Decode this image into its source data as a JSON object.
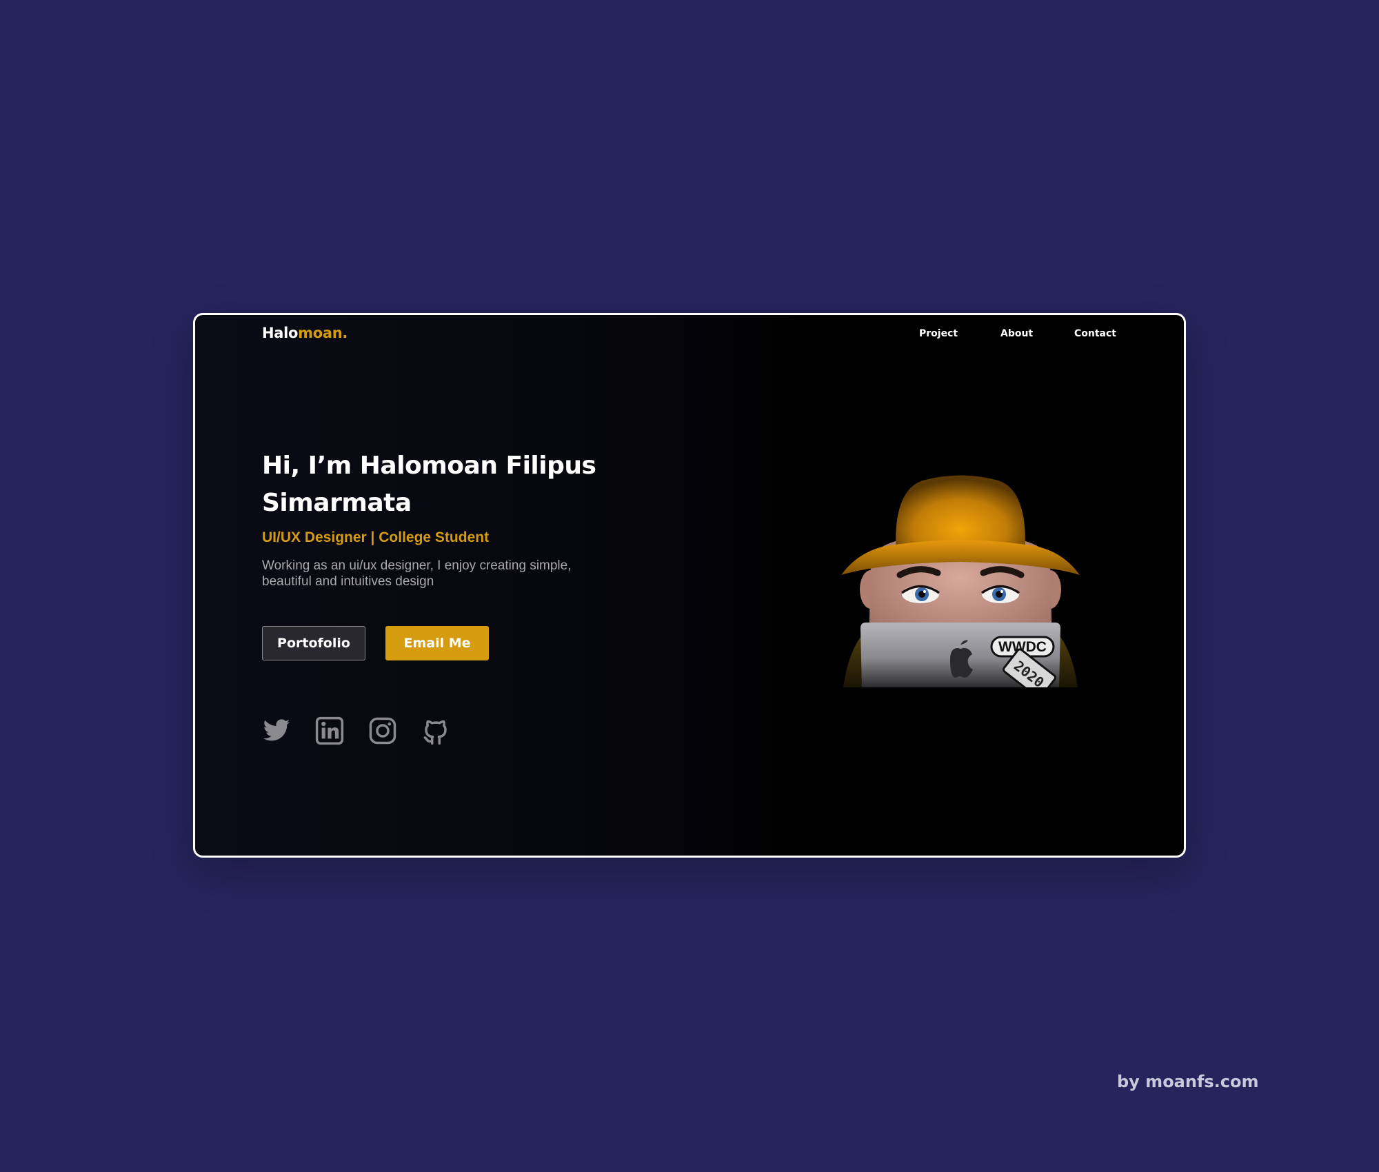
{
  "header": {
    "logo_part1": "Halo",
    "logo_part2": "moan.",
    "nav": [
      "Project",
      "About",
      "Contact"
    ]
  },
  "hero": {
    "title": "Hi, I’m Halomoan Filipus Simarmata",
    "subtitle": "UI/UX Designer | College Student",
    "description": "Working as an ui/ux designer,  I enjoy creating simple, beautiful and intuitives design",
    "buttons": {
      "portfolio": "Portofolio",
      "email": "Email Me"
    },
    "social_icons": [
      "twitter-icon",
      "linkedin-icon",
      "instagram-icon",
      "github-icon"
    ]
  },
  "illustration": {
    "sticker_text": "WWDC",
    "sticker_year": "2020"
  },
  "credit": "by moanfs.com",
  "colors": {
    "background": "#25245c",
    "accent": "#d59c10",
    "panel": "#000000",
    "icon_gray": "#8a8a90"
  }
}
